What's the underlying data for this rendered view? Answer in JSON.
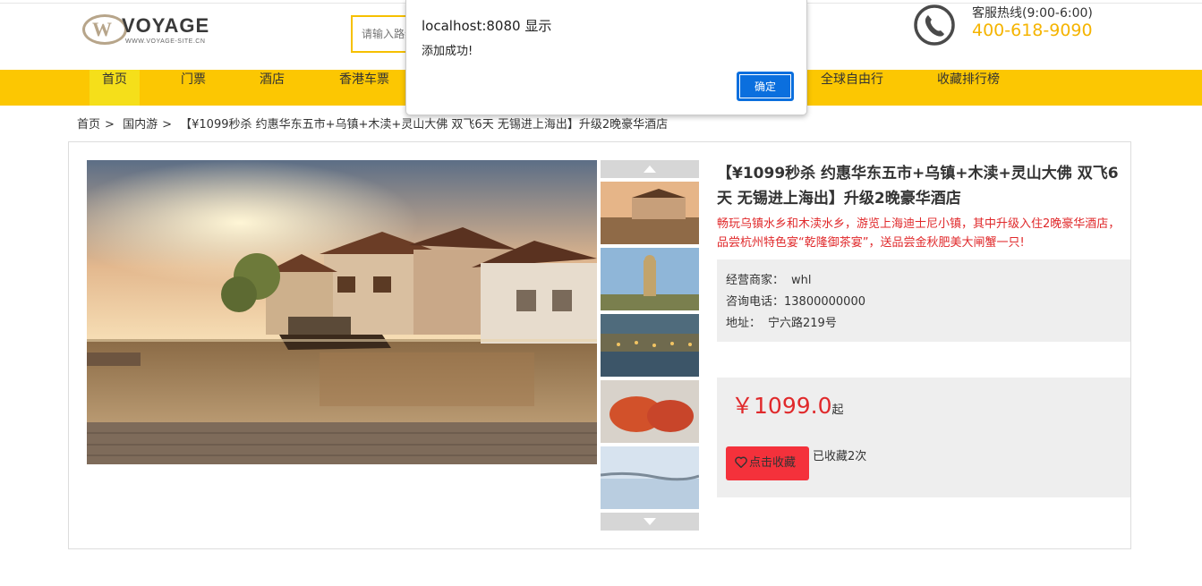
{
  "header": {
    "logo_text": "VOYAGE",
    "logo_subtext": "WWW.VOYAGE-SITE.CN",
    "search_placeholder": "请输入路线名称",
    "hotline_label": "客服热线(9:00-6:00)",
    "hotline_number": "400-618-9090"
  },
  "nav": {
    "items": [
      {
        "label": "首页",
        "active": true
      },
      {
        "label": "门票"
      },
      {
        "label": "酒店"
      },
      {
        "label": "香港车票"
      },
      {
        "label": "全球自由行"
      },
      {
        "label": "收藏排行榜"
      }
    ]
  },
  "breadcrumb": {
    "home": "首页",
    "sep": ">",
    "category": "国内游",
    "current": "【¥1099秒杀 约惠华东五市+乌镇+木渎+灵山大佛 双飞6天 无锡进上海出】升级2晚豪华酒店"
  },
  "product": {
    "title": "【¥1099秒杀 约惠华东五市+乌镇+木渎+灵山大佛 双飞6天 无锡进上海出】升级2晚豪华酒店",
    "description": "畅玩乌镇水乡和木渎水乡，游览上海迪士尼小镇，其中升级入住2晚豪华酒店，品尝杭州特色宴“乾隆御茶宴”，送品尝金秋肥美大闸蟹一只!",
    "merchant_label": "经营商家：",
    "merchant_value": "whl",
    "phone_label": "咨询电话：",
    "phone_value": "13800000000",
    "address_label": "地址：",
    "address_value": "宁六路219号",
    "price_symbol": "￥",
    "price": "1099.0",
    "price_suffix": "起",
    "favorite_button": "点击收藏",
    "favorite_count_text": "已收藏2次"
  },
  "dialog": {
    "title": "localhost:8080 显示",
    "message": "添加成功!",
    "ok_label": "确定"
  },
  "colors": {
    "nav_bg": "#fcc702",
    "nav_active": "#f5df1a",
    "accent_red": "#e0292b",
    "fav_btn": "#f4313b",
    "dialog_btn": "#0b6fde",
    "hotline": "#f5b400"
  },
  "icons": [
    "phone-icon",
    "heart-icon",
    "arrow-up-icon",
    "arrow-down-icon"
  ]
}
